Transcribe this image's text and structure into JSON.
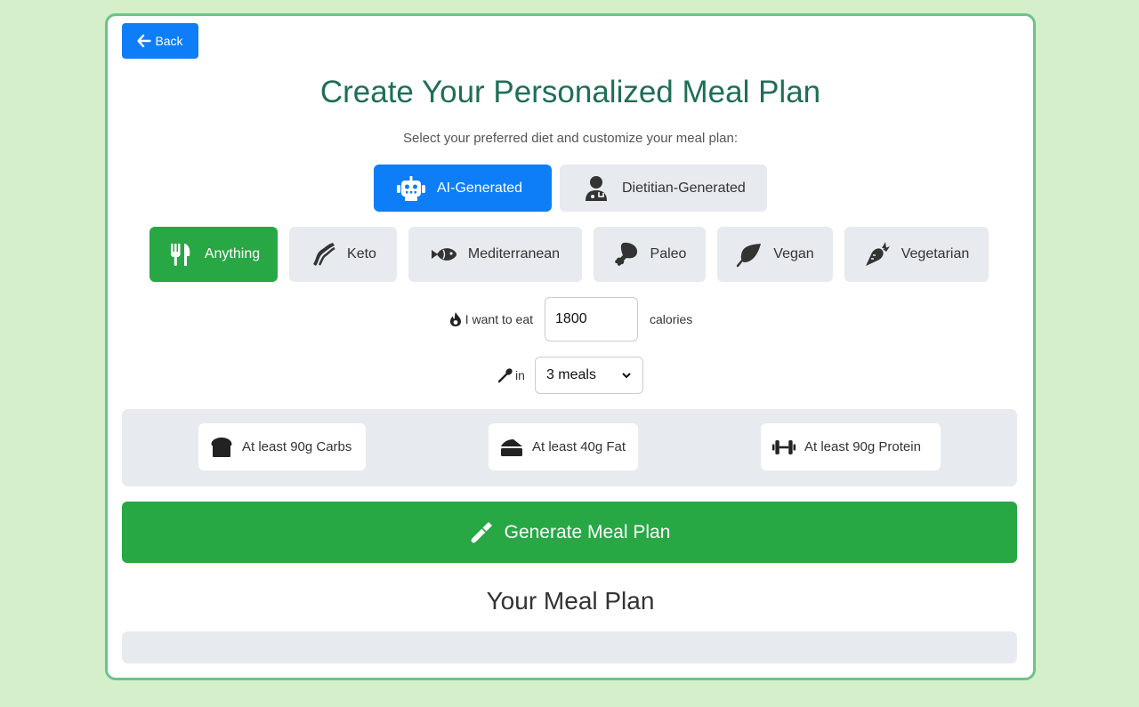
{
  "header": {
    "back_label": "Back",
    "title": "Create Your Personalized Meal Plan",
    "subtitle": "Select your preferred diet and customize your meal plan:"
  },
  "mode_options": [
    {
      "label": "AI-Generated",
      "icon": "robot-icon",
      "selected": true
    },
    {
      "label": "Dietitian-Generated",
      "icon": "doctor-icon",
      "selected": false
    }
  ],
  "diets": [
    {
      "label": "Anything",
      "icon": "utensils-icon",
      "selected": true
    },
    {
      "label": "Keto",
      "icon": "bacon-icon",
      "selected": false
    },
    {
      "label": "Mediterranean",
      "icon": "fish-icon",
      "selected": false
    },
    {
      "label": "Paleo",
      "icon": "drumstick-icon",
      "selected": false
    },
    {
      "label": "Vegan",
      "icon": "leaf-icon",
      "selected": false
    },
    {
      "label": "Vegetarian",
      "icon": "carrot-icon",
      "selected": false
    }
  ],
  "calories": {
    "prefix": "I want to eat",
    "value": "1800",
    "suffix": "calories"
  },
  "meals": {
    "prefix": "in",
    "selected": "3 meals"
  },
  "macros": [
    {
      "label": "At least 90g Carbs",
      "icon": "bread-icon"
    },
    {
      "label": "At least 40g Fat",
      "icon": "cheese-icon"
    },
    {
      "label": "At least 90g Protein",
      "icon": "dumbbell-icon"
    }
  ],
  "generate_label": "Generate Meal Plan",
  "plan_heading": "Your Meal Plan",
  "colors": {
    "background": "#d4efc9",
    "primary_blue": "#0d7ef7",
    "primary_green": "#28a745",
    "title_green": "#1f6e58",
    "card_border": "#6cc488",
    "neutral_button": "#e7eaee"
  }
}
